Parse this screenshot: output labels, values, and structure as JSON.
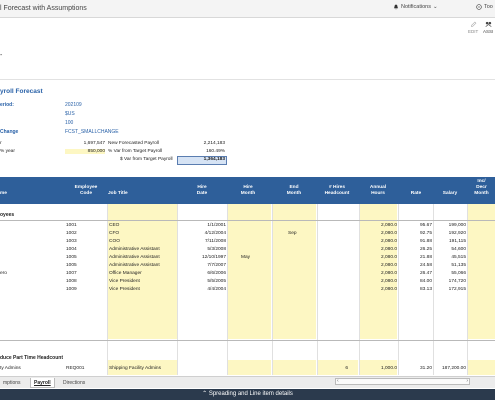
{
  "app": {
    "title": "l Forecast with Assumptions",
    "notifications_label": "Notifications",
    "tools_label": "Too"
  },
  "toolbar": {
    "edit_label": "EDIT",
    "assign_label": "ASSI"
  },
  "summary": {
    "title": "yroll Forecast",
    "params": [
      {
        "label": "eriod:",
        "value": "202109"
      },
      {
        "label": "",
        "value": "$US"
      },
      {
        "label": "",
        "value": "100"
      },
      {
        "label": "Change",
        "value": "FCST_SMALLCHANGE"
      }
    ],
    "rows": [
      {
        "left_label": "r",
        "left_value": "1,697,547",
        "right_label": "New Forecasted Payroll",
        "right_value": "2,214,183"
      },
      {
        "left_label": "% year",
        "left_value": "850,000",
        "right_label": "% Var from Target Payroll",
        "right_value": "160.49%"
      },
      {
        "left_label": "",
        "left_value": "",
        "right_label": "$ Var from Target Payroll",
        "right_value": "1,364,183"
      }
    ]
  },
  "grid": {
    "headers": {
      "name": "me",
      "employee_code": [
        "Employee",
        "Code"
      ],
      "job_title": "Job Title",
      "hire_date": [
        "Hire",
        "Date"
      ],
      "hire_month": [
        "Hire",
        "Month"
      ],
      "end_month": [
        "End",
        "Month"
      ],
      "hires_headcount": [
        "# Hires",
        "Headcount"
      ],
      "annual_hours": [
        "Annual",
        "Hours"
      ],
      "rate": "Rate",
      "salary": "Salary",
      "incdec": [
        "Inc/",
        "Decr",
        "Month"
      ]
    },
    "group1_label": "oyees",
    "rows": [
      {
        "name": "",
        "code": "1001",
        "title": "CEO",
        "hire": "1/1/2001",
        "hire_month": "",
        "end_month": "",
        "headcount": "",
        "hours": "2,080.0",
        "rate": "95.67",
        "salary": "199,000"
      },
      {
        "name": "",
        "code": "1002",
        "title": "CFO",
        "hire": "4/12/2004",
        "hire_month": "",
        "end_month": "Sep",
        "headcount": "",
        "hours": "2,080.0",
        "rate": "92.75",
        "salary": "192,920"
      },
      {
        "name": "",
        "code": "1003",
        "title": "COO",
        "hire": "7/11/2008",
        "hire_month": "",
        "end_month": "",
        "headcount": "",
        "hours": "2,080.0",
        "rate": "91.88",
        "salary": "191,115"
      },
      {
        "name": "",
        "code": "1004",
        "title": "Administrative Assistant",
        "hire": "5/3/2008",
        "hire_month": "",
        "end_month": "",
        "headcount": "",
        "hours": "2,080.0",
        "rate": "26.25",
        "salary": "54,600"
      },
      {
        "name": "",
        "code": "1005",
        "title": "Administrative Assistant",
        "hire": "12/10/1997",
        "hire_month": "May",
        "end_month": "",
        "headcount": "",
        "hours": "2,080.0",
        "rate": "21.88",
        "salary": "45,515"
      },
      {
        "name": "",
        "code": "1005",
        "title": "Administrative Assistant",
        "hire": "7/7/2007",
        "hire_month": "",
        "end_month": "",
        "headcount": "",
        "hours": "2,080.0",
        "rate": "24.58",
        "salary": "51,135"
      },
      {
        "name": "ero",
        "code": "1007",
        "title": "Office Manager",
        "hire": "6/6/2006",
        "hire_month": "",
        "end_month": "",
        "headcount": "",
        "hours": "2,080.0",
        "rate": "26.47",
        "salary": "55,066"
      },
      {
        "name": "",
        "code": "1008",
        "title": "Vice President",
        "hire": "5/5/2005",
        "hire_month": "",
        "end_month": "",
        "headcount": "",
        "hours": "2,080.0",
        "rate": "84.00",
        "salary": "174,720"
      },
      {
        "name": "",
        "code": "1009",
        "title": "Vice President",
        "hire": "4/4/2004",
        "hire_month": "",
        "end_month": "",
        "headcount": "",
        "hours": "2,080.0",
        "rate": "83.13",
        "salary": "172,915"
      }
    ],
    "group2_label": "duce Part Time Headcount",
    "rows2": [
      {
        "name": "ty Admins",
        "code": "REQ001",
        "title": "Shipping Facility Admins",
        "hire": "",
        "hire_month": "",
        "end_month": "",
        "headcount": "6",
        "hours": "1,000.0",
        "rate": "31.20",
        "salary": "187,200.00"
      }
    ]
  },
  "tabs": [
    "mptions",
    "Payroll",
    "Directions"
  ],
  "status_bar": "Spreading and Line item details"
}
